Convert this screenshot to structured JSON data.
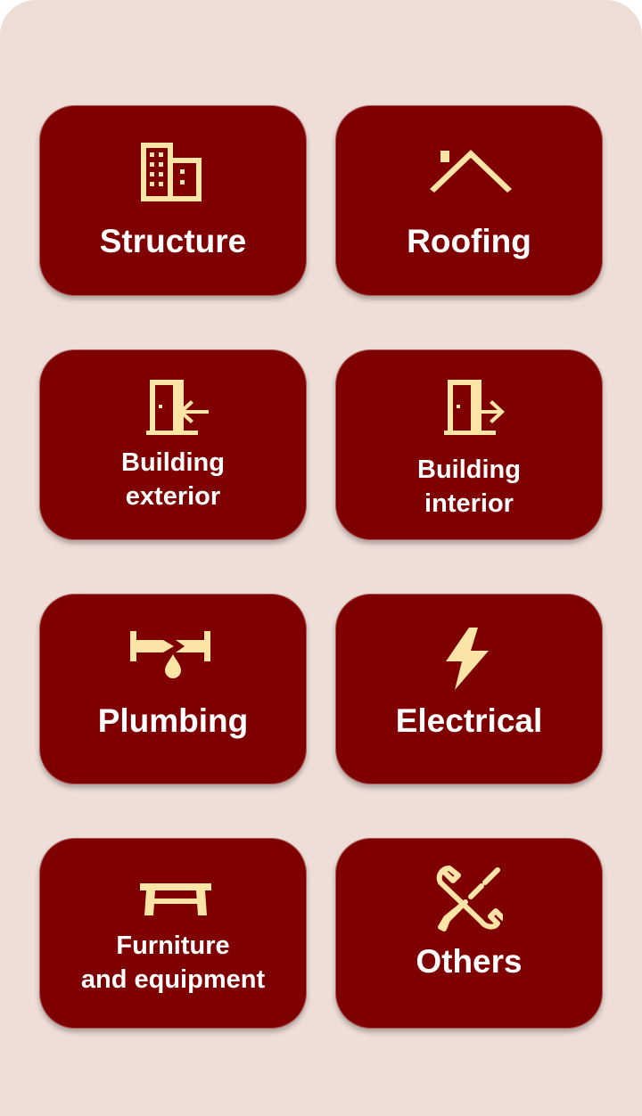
{
  "colors": {
    "background": "#eeded7",
    "tile": "#7f0000",
    "icon": "#fce3a6",
    "text": "#ffffff"
  },
  "categories": [
    {
      "label": "Structure",
      "icon": "building-icon"
    },
    {
      "label": "Roofing",
      "icon": "roof-icon"
    },
    {
      "label": "Building\nexterior",
      "icon": "door-exit-icon"
    },
    {
      "label": "Building\ninterior",
      "icon": "door-enter-icon"
    },
    {
      "label": "Plumbing",
      "icon": "pipe-leak-icon"
    },
    {
      "label": "Electrical",
      "icon": "lightning-icon"
    },
    {
      "label": "Furniture\nand equipment",
      "icon": "table-icon"
    },
    {
      "label": "Others",
      "icon": "tools-icon"
    }
  ]
}
